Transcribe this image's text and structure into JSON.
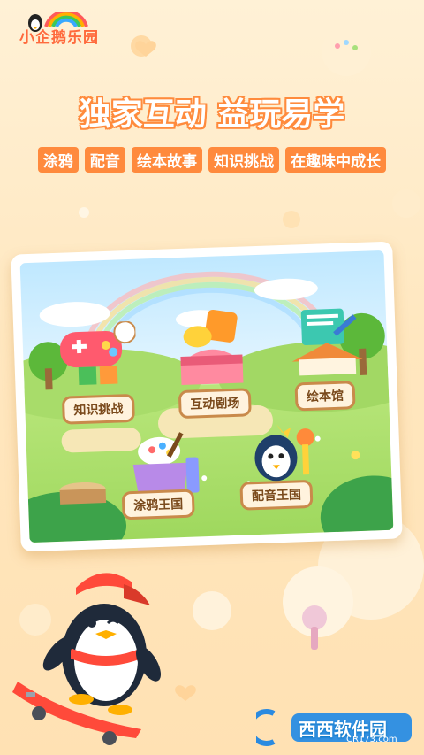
{
  "app": {
    "logo_text": "小企鹅乐园"
  },
  "headline": "独家互动 益玩易学",
  "subhead": {
    "tags": [
      "涂鸦",
      "配音",
      "绘本故事",
      "知识挑战",
      "在趣味中成长"
    ]
  },
  "scene": {
    "items": [
      {
        "label": "知识挑战",
        "icon": "gamepad-icon"
      },
      {
        "label": "互动剧场",
        "icon": "theater-icon"
      },
      {
        "label": "绘本馆",
        "icon": "book-icon"
      },
      {
        "label": "涂鸦王国",
        "icon": "paint-icon"
      },
      {
        "label": "配音王国",
        "icon": "penguin-mic-icon"
      }
    ]
  },
  "watermark": {
    "brand": "西西软件园",
    "url": "CR173.com"
  },
  "colors": {
    "accent": "#ff8a3d",
    "background": "#ffe7bf",
    "label_border": "#c98a4b"
  }
}
